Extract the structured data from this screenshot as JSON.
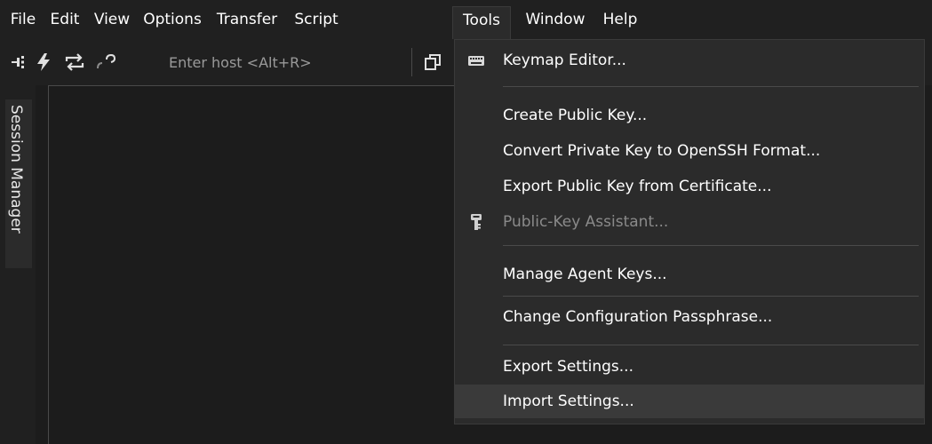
{
  "menubar": {
    "items": [
      {
        "label": "File"
      },
      {
        "label": "Edit"
      },
      {
        "label": "View"
      },
      {
        "label": "Options"
      },
      {
        "label": "Transfer"
      },
      {
        "label": "Script"
      },
      {
        "label": "Tools"
      },
      {
        "label": "Window"
      },
      {
        "label": "Help"
      }
    ],
    "open_menu": "Tools"
  },
  "toolbar": {
    "icons": [
      "connect-icon",
      "lightning-icon",
      "reconnect-icon",
      "disconnect-icon",
      "clone-session-icon",
      "keyboard-icon"
    ],
    "host_placeholder": "Enter host <Alt+R>"
  },
  "side_panel": {
    "tab_label": "Session Manager"
  },
  "tools_menu": {
    "items": [
      {
        "label": "Keymap Editor...",
        "icon": "keyboard-icon",
        "disabled": false
      },
      {
        "label": "Create Public Key...",
        "disabled": false
      },
      {
        "label": "Convert Private Key to OpenSSH Format...",
        "disabled": false
      },
      {
        "label": "Export Public Key from Certificate...",
        "disabled": false
      },
      {
        "label": "Public-Key Assistant...",
        "icon": "key-icon",
        "disabled": true
      },
      {
        "label": "Manage Agent Keys...",
        "disabled": false
      },
      {
        "label": "Change Configuration Passphrase...",
        "disabled": false
      },
      {
        "label": "Export Settings...",
        "disabled": false
      },
      {
        "label": "Import Settings...",
        "disabled": false,
        "hovered": true
      }
    ]
  },
  "colors": {
    "background": "#1c1c1c",
    "menu_background": "#2b2b2b",
    "hover": "#3a3a3a",
    "disabled_text": "#8a8a8a",
    "icon_yellow": "#f0c419"
  }
}
